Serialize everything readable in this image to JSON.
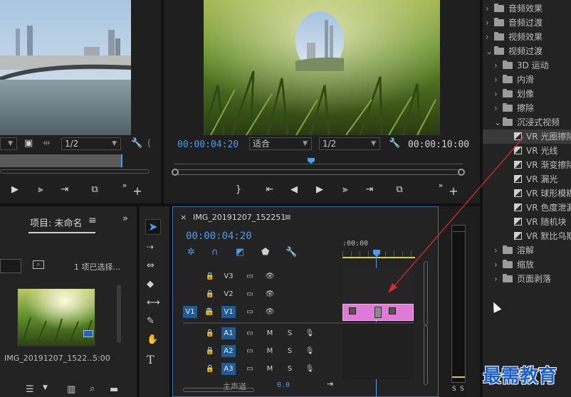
{
  "source_monitor": {
    "resolution": "1/2"
  },
  "program_monitor": {
    "timecode_current": "00:00:04:20",
    "fit_label": "适合",
    "resolution": "1/2",
    "timecode_total": "00:00:10:00"
  },
  "project_panel": {
    "title": "项目: 未命名",
    "menu_icon": "≡",
    "selection_info": "1 项已选择...",
    "clip_name": "IMG_20191207_1522...",
    "clip_duration": "5:00"
  },
  "timeline": {
    "sequence_name": "IMG_20191207_152251",
    "menu_icon": "≡",
    "timecode": "00:00:04:20",
    "ruler_label": ":00:00",
    "tracks_video": [
      {
        "src": "",
        "label": "V3"
      },
      {
        "src": "",
        "label": "V2"
      },
      {
        "src": "V1",
        "label": "V1"
      }
    ],
    "tracks_audio": [
      {
        "label": "A1",
        "m": "M",
        "s": "S"
      },
      {
        "label": "A2",
        "m": "M",
        "s": "S"
      },
      {
        "label": "A3",
        "m": "M",
        "s": "S"
      }
    ],
    "master_label": "主声道",
    "master_value": "0.0"
  },
  "effects_tree": [
    {
      "kind": "folder",
      "label": "音频效果",
      "expanded": false
    },
    {
      "kind": "folder",
      "label": "音频过渡",
      "expanded": false
    },
    {
      "kind": "folder",
      "label": "视频效果",
      "expanded": false
    },
    {
      "kind": "folder",
      "label": "视频过渡",
      "expanded": true
    },
    {
      "kind": "sub",
      "label": "3D 运动"
    },
    {
      "kind": "sub",
      "label": "内滑"
    },
    {
      "kind": "sub",
      "label": "划像"
    },
    {
      "kind": "sub",
      "label": "擦除"
    },
    {
      "kind": "subopen",
      "label": "沉浸式视频"
    },
    {
      "kind": "fx",
      "label": "VR 光圈擦除",
      "selected": true
    },
    {
      "kind": "fx",
      "label": "VR 光线"
    },
    {
      "kind": "fx",
      "label": "VR 渐变擦除"
    },
    {
      "kind": "fx",
      "label": "VR 漏光"
    },
    {
      "kind": "fx",
      "label": "VR 球形模糊"
    },
    {
      "kind": "fx",
      "label": "VR 色度泄漏"
    },
    {
      "kind": "fx",
      "label": "VR 随机块"
    },
    {
      "kind": "fx",
      "label": "VR 默比乌斯"
    },
    {
      "kind": "sub",
      "label": "溶解"
    },
    {
      "kind": "sub",
      "label": "缩放"
    },
    {
      "kind": "sub",
      "label": "页面剥落"
    }
  ],
  "audio_meter": {
    "solo_left": "S",
    "solo_right": "S"
  },
  "watermark": "最需教育",
  "colors": {
    "accent_blue": "#4b9cf0",
    "clip_pink": "#e07ad8",
    "playhead": "#4b9cf0",
    "in_out_bar": "#d8d21f"
  }
}
